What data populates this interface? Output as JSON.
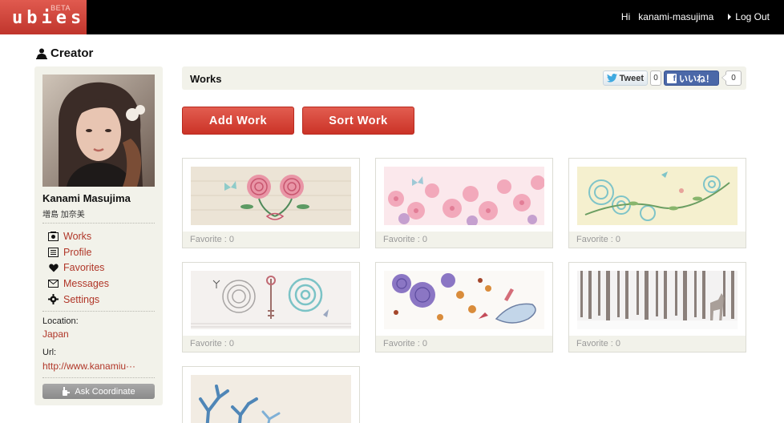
{
  "app": {
    "brand": "ubies",
    "beta": "BETA"
  },
  "topnav": {
    "greeting": "Hi",
    "username": "kanami-masujima",
    "logout_label": "Log Out"
  },
  "page": {
    "section_title": "Creator"
  },
  "creator": {
    "name": "Kanami Masujima",
    "name_ja": "増島 加奈美",
    "location_label": "Location:",
    "location_value": "Japan",
    "url_label": "Url:",
    "url_value": "http://www.kanamiu···",
    "ask_button_label": "Ask Coordinate"
  },
  "sidebar": {
    "menu": [
      {
        "label": "Works",
        "icon": "image-icon"
      },
      {
        "label": "Profile",
        "icon": "profile-icon"
      },
      {
        "label": "Favorites",
        "icon": "heart-icon"
      },
      {
        "label": "Messages",
        "icon": "envelope-icon"
      },
      {
        "label": "Settings",
        "icon": "gear-icon"
      }
    ]
  },
  "works": {
    "title": "Works",
    "share": {
      "tweet_label": "Tweet",
      "tweet_count": "0",
      "like_label": "いいね！",
      "like_count": "0"
    },
    "add_button_label": "Add Work",
    "sort_button_label": "Sort Work",
    "items": [
      {
        "favorite": "Favorite : 0",
        "art": "pink-roses-ribbon"
      },
      {
        "favorite": "Favorite : 0",
        "art": "sakura-blossoms"
      },
      {
        "favorite": "Favorite : 0",
        "art": "teal-flowers-vine"
      },
      {
        "favorite": "Favorite : 0",
        "art": "lace-flower-key"
      },
      {
        "favorite": "Favorite : 0",
        "art": "purple-flowers-shoes"
      },
      {
        "favorite": "Favorite : 0",
        "art": "birch-forest-deer"
      },
      {
        "favorite": "",
        "art": "blue-coral"
      }
    ]
  },
  "colors": {
    "brand_red": "#cb3327",
    "link_red": "#b03628",
    "panel_bg": "#f2f2ea",
    "topbar_bg": "#000000",
    "facebook_blue": "#4b68a8"
  }
}
